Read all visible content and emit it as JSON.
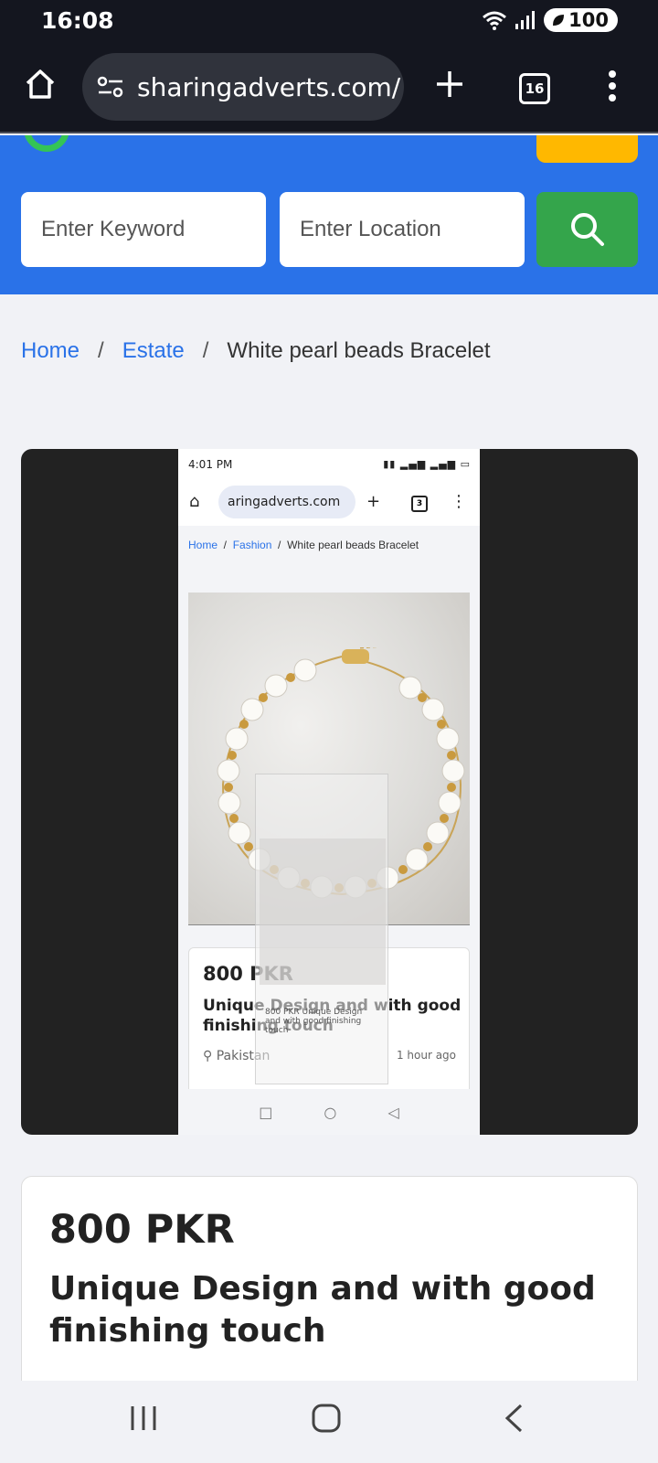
{
  "status_bar": {
    "time": "16:08",
    "battery": "100"
  },
  "browser": {
    "url": "sharingadverts.com/",
    "tab_count": "16"
  },
  "search": {
    "keyword_placeholder": "Enter Keyword",
    "location_placeholder": "Enter Location"
  },
  "breadcrumb": {
    "home": "Home",
    "sep": "/",
    "category": "Estate",
    "current": "White pearl beads Bracelet"
  },
  "gallery_screenshot": {
    "time": "4:01 PM",
    "url": "aringadverts.com",
    "tab_count": "3",
    "breadcrumb_home": "Home",
    "breadcrumb_category": "Fashion",
    "breadcrumb_current": "White pearl beads Bracelet",
    "price": "800 PKR",
    "title": "Unique Design and with good finishing touch",
    "location": "Pakistan",
    "posted": "1 hour ago",
    "nested_text": "800 PKR Unique Design and with good finishing touch"
  },
  "listing": {
    "price": "800 PKR",
    "title": "Unique Design and with good finishing touch"
  },
  "colors": {
    "brand_blue": "#2a72e8",
    "search_green": "#34a54b",
    "accent_yellow": "#ffb800"
  }
}
